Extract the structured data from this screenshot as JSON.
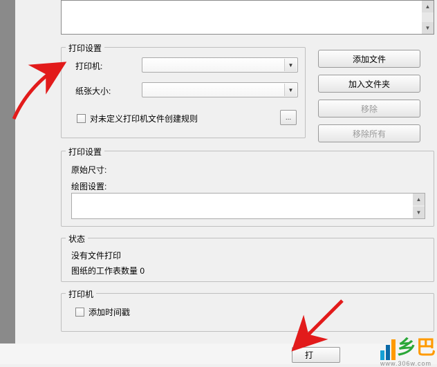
{
  "print_settings1": {
    "title": "打印设置",
    "printer_label": "打印机:",
    "paper_label": "纸张大小:",
    "checkbox_label": "对未定义打印机文件创建规则",
    "browse_icon": "..."
  },
  "right_buttons": {
    "add_file": "添加文件",
    "add_folder": "加入文件夹",
    "remove": "移除",
    "remove_all": "移除所有"
  },
  "print_settings2": {
    "title": "打印设置",
    "orig_size": "原始尺寸:",
    "draw_settings": "绘图设置:"
  },
  "status": {
    "title": "状态",
    "no_files": "没有文件打印",
    "sheet_count": "图纸的工作表数量 0"
  },
  "printer": {
    "title": "打印机",
    "add_timestamp": "添加时间戳"
  },
  "bottom": {
    "print": "打"
  },
  "watermark": {
    "c1": "乡",
    "c2": "巴",
    "sub": "www.306w.com"
  }
}
